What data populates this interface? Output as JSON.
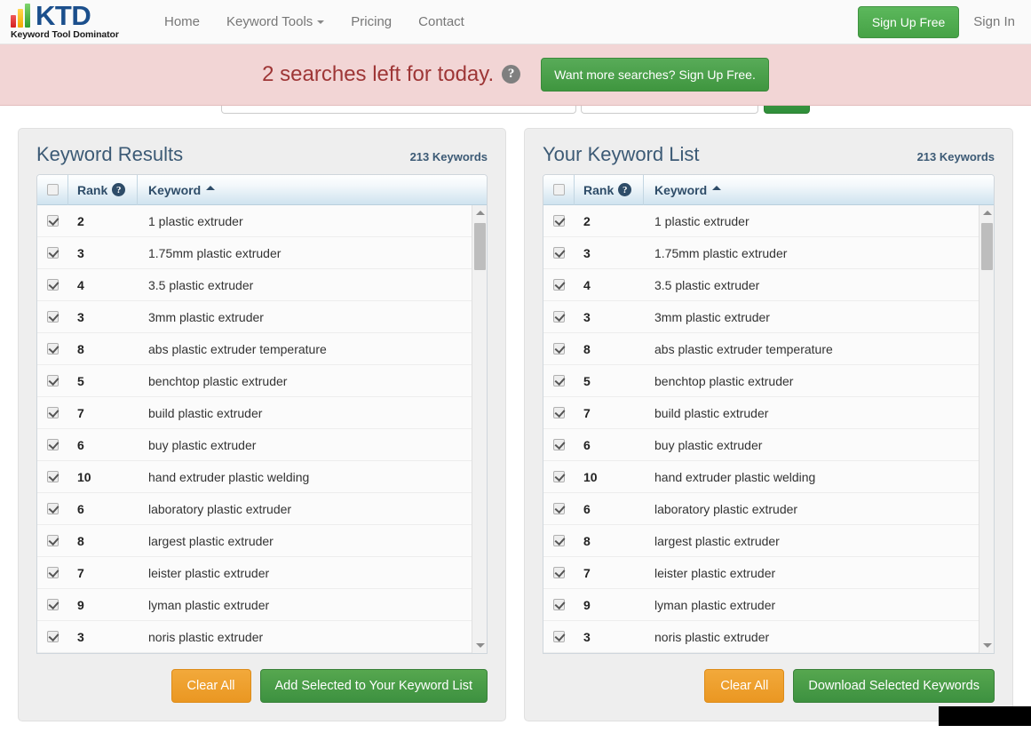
{
  "navbar": {
    "brand_name": "KTD",
    "brand_tagline": "Keyword Tool Dominator",
    "links": [
      {
        "label": "Home",
        "has_caret": false
      },
      {
        "label": "Keyword Tools",
        "has_caret": true
      },
      {
        "label": "Pricing",
        "has_caret": false
      },
      {
        "label": "Contact",
        "has_caret": false
      }
    ],
    "signup_label": "Sign Up Free",
    "signin_label": "Sign In"
  },
  "notice_bar": {
    "message": "2 searches left for today.",
    "help_icon": "question-mark-icon",
    "help_glyph": "?",
    "cta_label": "Want more searches? Sign Up Free.",
    "background_color": "#f2d5d5",
    "text_color": "#9e3636",
    "cta_color": "#4aa04a"
  },
  "yellow_alert": {
    "text": ""
  },
  "table_header": {
    "rank_label": "Rank",
    "rank_help_glyph": "?",
    "keyword_label": "Keyword",
    "sort_direction": "asc"
  },
  "panels": [
    {
      "id": "keyword-results",
      "title": "Keyword Results",
      "count_label": "213 Keywords",
      "rows": [
        {
          "rank": "2",
          "keyword": "1 plastic extruder",
          "checked": true
        },
        {
          "rank": "3",
          "keyword": "1.75mm plastic extruder",
          "checked": true
        },
        {
          "rank": "4",
          "keyword": "3.5 plastic extruder",
          "checked": true
        },
        {
          "rank": "3",
          "keyword": "3mm plastic extruder",
          "checked": true
        },
        {
          "rank": "8",
          "keyword": "abs plastic extruder temperature",
          "checked": true
        },
        {
          "rank": "5",
          "keyword": "benchtop plastic extruder",
          "checked": true
        },
        {
          "rank": "7",
          "keyword": "build plastic extruder",
          "checked": true
        },
        {
          "rank": "6",
          "keyword": "buy plastic extruder",
          "checked": true
        },
        {
          "rank": "10",
          "keyword": "hand extruder plastic welding",
          "checked": true
        },
        {
          "rank": "6",
          "keyword": "laboratory plastic extruder",
          "checked": true
        },
        {
          "rank": "8",
          "keyword": "largest plastic extruder",
          "checked": true
        },
        {
          "rank": "7",
          "keyword": "leister plastic extruder",
          "checked": true
        },
        {
          "rank": "9",
          "keyword": "lyman plastic extruder",
          "checked": true
        },
        {
          "rank": "3",
          "keyword": "noris plastic extruder",
          "checked": true
        }
      ],
      "clear_label": "Clear All",
      "primary_label": "Add Selected to Your Keyword List"
    },
    {
      "id": "your-keyword-list",
      "title": "Your Keyword List",
      "count_label": "213 Keywords",
      "rows": [
        {
          "rank": "2",
          "keyword": "1 plastic extruder",
          "checked": true
        },
        {
          "rank": "3",
          "keyword": "1.75mm plastic extruder",
          "checked": true
        },
        {
          "rank": "4",
          "keyword": "3.5 plastic extruder",
          "checked": true
        },
        {
          "rank": "3",
          "keyword": "3mm plastic extruder",
          "checked": true
        },
        {
          "rank": "8",
          "keyword": "abs plastic extruder temperature",
          "checked": true
        },
        {
          "rank": "5",
          "keyword": "benchtop plastic extruder",
          "checked": true
        },
        {
          "rank": "7",
          "keyword": "build plastic extruder",
          "checked": true
        },
        {
          "rank": "6",
          "keyword": "buy plastic extruder",
          "checked": true
        },
        {
          "rank": "10",
          "keyword": "hand extruder plastic welding",
          "checked": true
        },
        {
          "rank": "6",
          "keyword": "laboratory plastic extruder",
          "checked": true
        },
        {
          "rank": "8",
          "keyword": "largest plastic extruder",
          "checked": true
        },
        {
          "rank": "7",
          "keyword": "leister plastic extruder",
          "checked": true
        },
        {
          "rank": "9",
          "keyword": "lyman plastic extruder",
          "checked": true
        },
        {
          "rank": "3",
          "keyword": "noris plastic extruder",
          "checked": true
        }
      ],
      "clear_label": "Clear All",
      "primary_label": "Download Selected Keywords"
    }
  ],
  "colors": {
    "brand_blue": "#1b4f8c",
    "green": "#4aa04a",
    "orange": "#ea9722",
    "header_text": "#2e4c68",
    "panel_bg": "#eeeeee"
  }
}
